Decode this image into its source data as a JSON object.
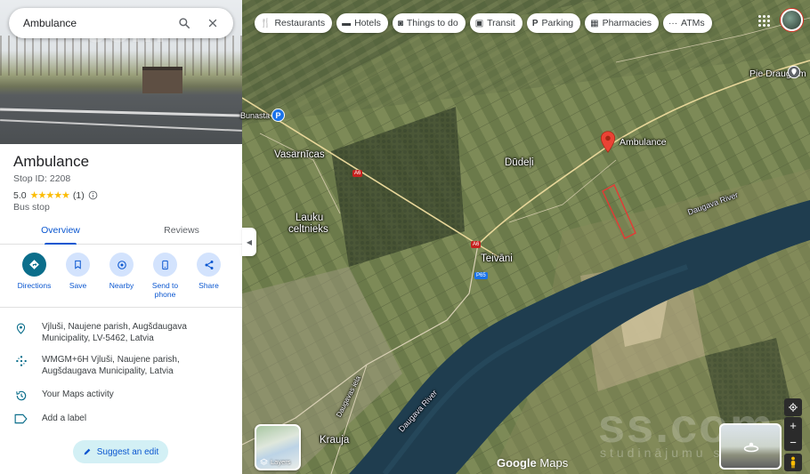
{
  "search": {
    "value": "Ambulance"
  },
  "place": {
    "title": "Ambulance",
    "stop_id": "Stop ID: 2208",
    "rating": "5.0",
    "stars": "★★★★★",
    "review_count": "(1)",
    "category": "Bus stop"
  },
  "tabs": [
    {
      "label": "Overview",
      "active": true
    },
    {
      "label": "Reviews",
      "active": false
    }
  ],
  "actions": [
    {
      "label": "Directions",
      "icon": "directions-icon"
    },
    {
      "label": "Save",
      "icon": "bookmark-icon"
    },
    {
      "label": "Nearby",
      "icon": "nearby-icon"
    },
    {
      "label": "Send to phone",
      "icon": "phone-icon"
    },
    {
      "label": "Share",
      "icon": "share-icon"
    }
  ],
  "info": {
    "address": "Vjluši, Naujene parish, Augšdaugava Municipality, LV-5462, Latvia",
    "plus_code": "WMGM+6H Vjluši, Naujene parish, Augšdaugava Municipality, Latvia",
    "activity": "Your Maps activity",
    "label": "Add a label"
  },
  "suggest_edit": "Suggest an edit",
  "chips": [
    {
      "label": "Restaurants",
      "icon": "fork-knife-icon"
    },
    {
      "label": "Hotels",
      "icon": "bed-icon"
    },
    {
      "label": "Things to do",
      "icon": "camera-icon"
    },
    {
      "label": "Transit",
      "icon": "train-icon"
    },
    {
      "label": "Parking",
      "icon": "parking-icon"
    },
    {
      "label": "Pharmacies",
      "icon": "pharmacy-icon"
    },
    {
      "label": "ATMs",
      "icon": "atm-icon"
    }
  ],
  "map_labels": {
    "place_marker": "Ambulance",
    "vasarnicas": "Vasarnīcas",
    "dudeli": "Dūdeļi",
    "lauku1": "Lauku",
    "lauku2": "celtnieks",
    "teivani": "Teivāni",
    "krauja": "Krauja",
    "daugava_river_1": "Daugava River",
    "daugava_river_2": "Daugava River",
    "daugavas_iela": "Daugavas iela",
    "pie_draugiem": "Pie Draugiem",
    "bunasta": "Bunasta",
    "route_a6_1": "A6",
    "route_a6_2": "A6",
    "route_p65": "P65",
    "parking_badge": "P"
  },
  "layers_label": "Layers",
  "google_logo": {
    "google": "Google",
    "maps": "Maps"
  },
  "watermark": {
    "main": "ss.com",
    "sub": "studinājumu serviss",
    "panel": "com"
  },
  "colors": {
    "accent": "#0b57d0",
    "pin": "#ea4335",
    "primary_action": "#0b6e8b"
  }
}
